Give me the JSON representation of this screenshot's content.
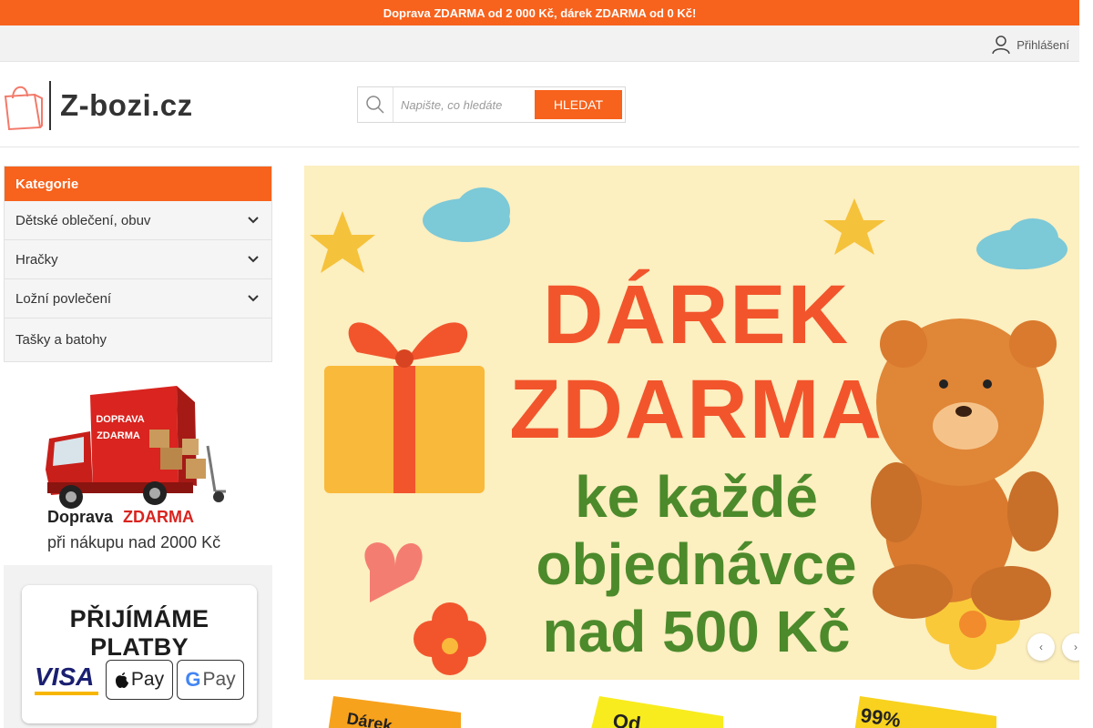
{
  "topbar": {
    "text": "Doprava ZDARMA od 2 000 Kč, dárek ZDARMA od 0 Kč!"
  },
  "userbar": {
    "login_label": "Přihlášení"
  },
  "header": {
    "logo_text": "Z-bozi.cz",
    "search": {
      "placeholder": "Napište, co hledáte",
      "button_label": "HLEDAT"
    }
  },
  "categories": {
    "title": "Kategorie",
    "items": [
      {
        "label": "Dětské oblečení, obuv",
        "has_children": true
      },
      {
        "label": "Hračky",
        "has_children": true
      },
      {
        "label": "Ložní povlečení",
        "has_children": true
      },
      {
        "label": "Tašky a batohy",
        "has_children": false
      }
    ]
  },
  "shipping_promo": {
    "truck_line1": "DOPRAVA",
    "truck_line2": "ZDARMA",
    "heading_a": "Doprava",
    "heading_b": "ZDARMA",
    "subtext": "při nákupu nad 2000 Kč"
  },
  "payments": {
    "title": "PŘIJÍMÁME PLATBY",
    "methods": [
      "VISA",
      "Pay",
      "Pay"
    ]
  },
  "slider": {
    "line1": "DÁREK",
    "line2": "ZDARMA",
    "line3": "ke každé",
    "line4": "objednávce",
    "line5": "nad 500 Kč"
  },
  "thumbs": {
    "t1": "Dárek",
    "t2": "Od",
    "t3": "99%"
  },
  "colors": {
    "accent": "#f7621c",
    "banner_bg": "#fcefc0",
    "banner_red": "#f2552c",
    "banner_green": "#4c8a2b"
  }
}
